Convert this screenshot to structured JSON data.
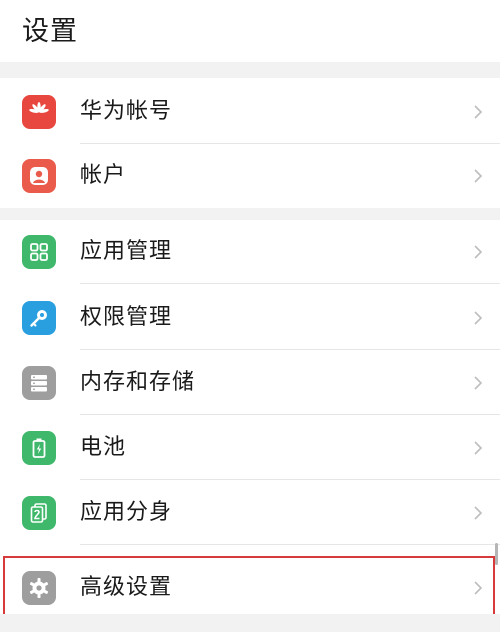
{
  "header": {
    "title": "设置"
  },
  "section1": {
    "items": [
      {
        "label": "华为帐号",
        "icon": "huawei-logo-icon",
        "color": "#e8473f"
      },
      {
        "label": "帐户",
        "icon": "account-person-icon",
        "color": "#ea5b4c"
      }
    ]
  },
  "section2": {
    "items": [
      {
        "label": "应用管理",
        "icon": "app-grid-icon",
        "color": "#3fb86b"
      },
      {
        "label": "权限管理",
        "icon": "key-icon",
        "color": "#2a9fe0"
      },
      {
        "label": "内存和存储",
        "icon": "storage-icon",
        "color": "#9e9e9e"
      },
      {
        "label": "电池",
        "icon": "battery-icon",
        "color": "#3fb86b"
      },
      {
        "label": "应用分身",
        "icon": "app-twin-icon",
        "color": "#3fb86b"
      },
      {
        "label": "高级设置",
        "icon": "gear-icon",
        "color": "#9e9e9e",
        "highlighted": true
      }
    ]
  },
  "colors": {
    "highlight_border": "#d63a3a",
    "section_gap": "#f2f2f2"
  }
}
